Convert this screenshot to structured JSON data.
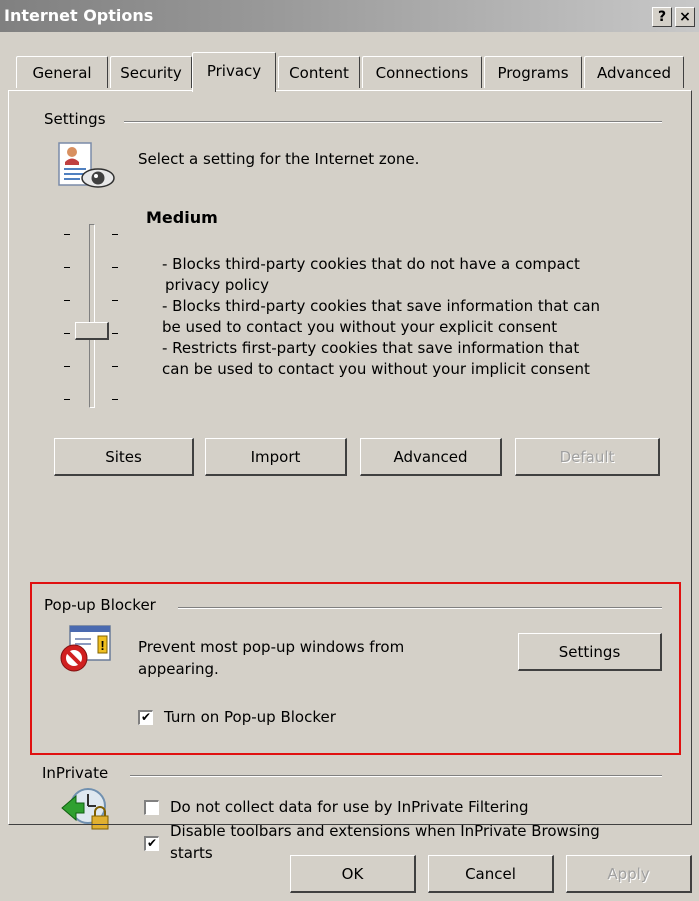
{
  "window": {
    "title": "Internet Options",
    "help": "?",
    "close": "×"
  },
  "tabs": [
    {
      "label": "General"
    },
    {
      "label": "Security"
    },
    {
      "label": "Privacy",
      "active": true
    },
    {
      "label": "Content"
    },
    {
      "label": "Connections"
    },
    {
      "label": "Programs"
    },
    {
      "label": "Advanced"
    }
  ],
  "settings": {
    "group_label": "Settings",
    "prompt": "Select a setting for the Internet zone.",
    "level": "Medium",
    "level_index": 3,
    "level_count": 6,
    "description": [
      "- Blocks third-party cookies that do not have a compact",
      "privacy policy",
      "- Blocks third-party cookies that save information that can",
      "be used to contact you without your explicit consent",
      "- Restricts first-party cookies that save information that",
      "can be used to contact you without your implicit consent"
    ],
    "buttons": {
      "sites": "Sites",
      "import": "Import",
      "advanced": "Advanced",
      "default": "Default"
    }
  },
  "popup_blocker": {
    "group_label": "Pop-up Blocker",
    "text_line1": "Prevent most pop-up windows from",
    "text_line2": "appearing.",
    "settings_button": "Settings",
    "checkbox_label": "Turn on Pop-up Blocker",
    "checked": true
  },
  "inprivate": {
    "group_label": "InPrivate",
    "filter_label": "Do not collect data for use by InPrivate Filtering",
    "filter_checked": false,
    "toolbar_label_line1": "Disable toolbars and extensions when InPrivate Browsing",
    "toolbar_label_line2": "starts",
    "toolbar_checked": true
  },
  "footer": {
    "ok": "OK",
    "cancel": "Cancel",
    "apply": "Apply"
  },
  "icons": {
    "privacy": "privacy-eye-icon",
    "popup": "popup-blocked-icon",
    "inprivate": "inprivate-lock-icon"
  },
  "colors": {
    "highlight_box": "#e01010",
    "dialog_bg": "#d4d0c8"
  }
}
